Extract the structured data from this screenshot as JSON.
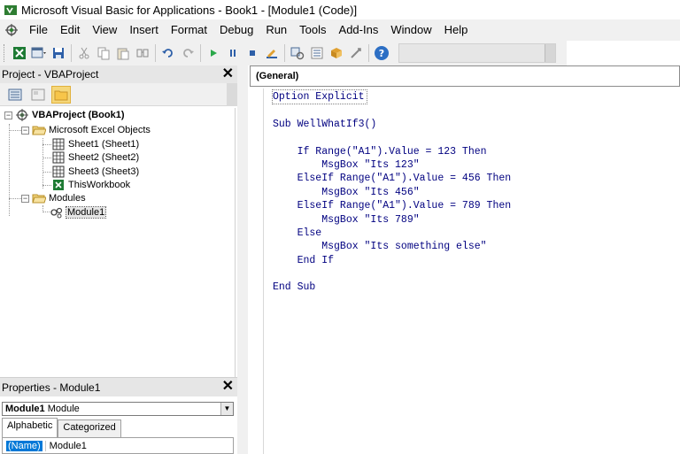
{
  "window": {
    "title": "Microsoft Visual Basic for Applications - Book1 - [Module1 (Code)]"
  },
  "menu": {
    "items": [
      "File",
      "Edit",
      "View",
      "Insert",
      "Format",
      "Debug",
      "Run",
      "Tools",
      "Add-Ins",
      "Window",
      "Help"
    ]
  },
  "toolbar": {
    "icons": [
      "view-excel-icon",
      "insert-userform-icon",
      "save-icon",
      "cut-icon",
      "copy-icon",
      "paste-icon",
      "find-icon",
      "undo-icon",
      "redo-icon",
      "run-icon",
      "break-icon",
      "reset-icon",
      "design-mode-icon",
      "project-explorer-icon",
      "properties-icon",
      "object-browser-icon",
      "toolbox-icon",
      "help-icon"
    ]
  },
  "project": {
    "title": "Project - VBAProject",
    "tree": {
      "root": "VBAProject (Book1)",
      "excel_objects": "Microsoft Excel Objects",
      "sheet1": "Sheet1 (Sheet1)",
      "sheet2": "Sheet2 (Sheet2)",
      "sheet3": "Sheet3 (Sheet3)",
      "workbook": "ThisWorkbook",
      "modules": "Modules",
      "module1": "Module1"
    }
  },
  "properties": {
    "title": "Properties - Module1",
    "object_name": "Module1",
    "object_type": "Module",
    "tabs": [
      "Alphabetic",
      "Categorized"
    ],
    "row_name": "(Name)",
    "row_value": "Module1"
  },
  "code": {
    "object_combo": "(General)",
    "lines": [
      "Option Explicit",
      "",
      "Sub WellWhatIf3()",
      "",
      "    If Range(\"A1\").Value = 123 Then",
      "        MsgBox \"Its 123\"",
      "    ElseIf Range(\"A1\").Value = 456 Then",
      "        MsgBox \"Its 456\"",
      "    ElseIf Range(\"A1\").Value = 789 Then",
      "        MsgBox \"Its 789\"",
      "    Else",
      "        MsgBox \"Its something else\"",
      "    End If",
      "",
      "End Sub"
    ]
  },
  "colors": {
    "code_text": "#000080",
    "selection": "#0078d7",
    "active_button": "#f5d77a"
  }
}
